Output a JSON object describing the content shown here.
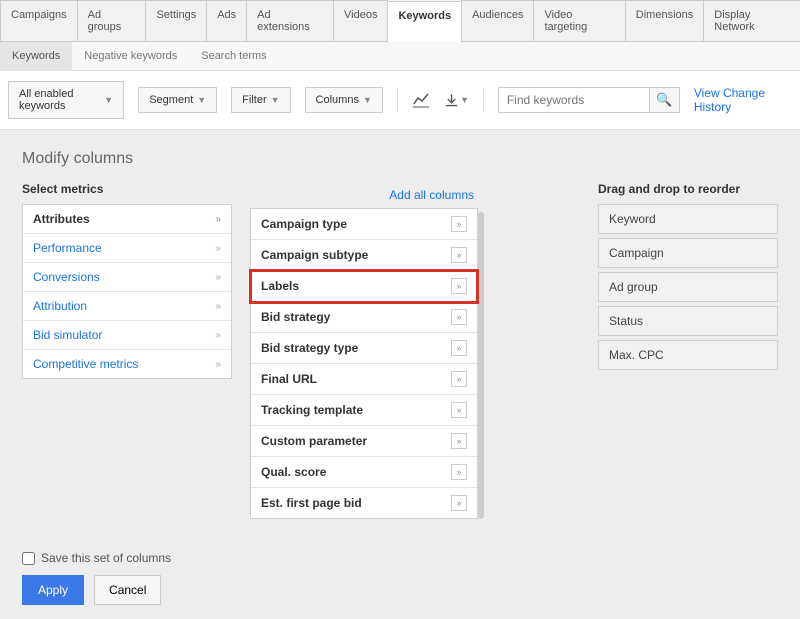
{
  "mainTabs": [
    "Campaigns",
    "Ad groups",
    "Settings",
    "Ads",
    "Ad extensions",
    "Videos",
    "Keywords",
    "Audiences",
    "Video targeting",
    "Dimensions",
    "Display Network"
  ],
  "mainActive": 6,
  "subTabs": [
    "Keywords",
    "Negative keywords",
    "Search terms"
  ],
  "subActive": 0,
  "toolbar": {
    "enabled": "All enabled keywords",
    "segment": "Segment",
    "filter": "Filter",
    "columns": "Columns",
    "searchPlaceholder": "Find keywords",
    "historyLink": "View Change History"
  },
  "panel": {
    "title": "Modify columns",
    "selectMetrics": "Select metrics",
    "categories": [
      "Attributes",
      "Performance",
      "Conversions",
      "Attribution",
      "Bid simulator",
      "Competitive metrics"
    ],
    "catActive": 0,
    "addAll": "Add all columns",
    "attributes": [
      "Campaign type",
      "Campaign subtype",
      "Labels",
      "Bid strategy",
      "Bid strategy type",
      "Final URL",
      "Tracking template",
      "Custom parameter",
      "Qual. score",
      "Est. first page bid"
    ],
    "highlightIdx": 2,
    "reorderTitle": "Drag and drop to reorder",
    "reorder": [
      "Keyword",
      "Campaign",
      "Ad group",
      "Status",
      "Max. CPC"
    ],
    "saveSet": "Save this set of columns",
    "apply": "Apply",
    "cancel": "Cancel"
  }
}
